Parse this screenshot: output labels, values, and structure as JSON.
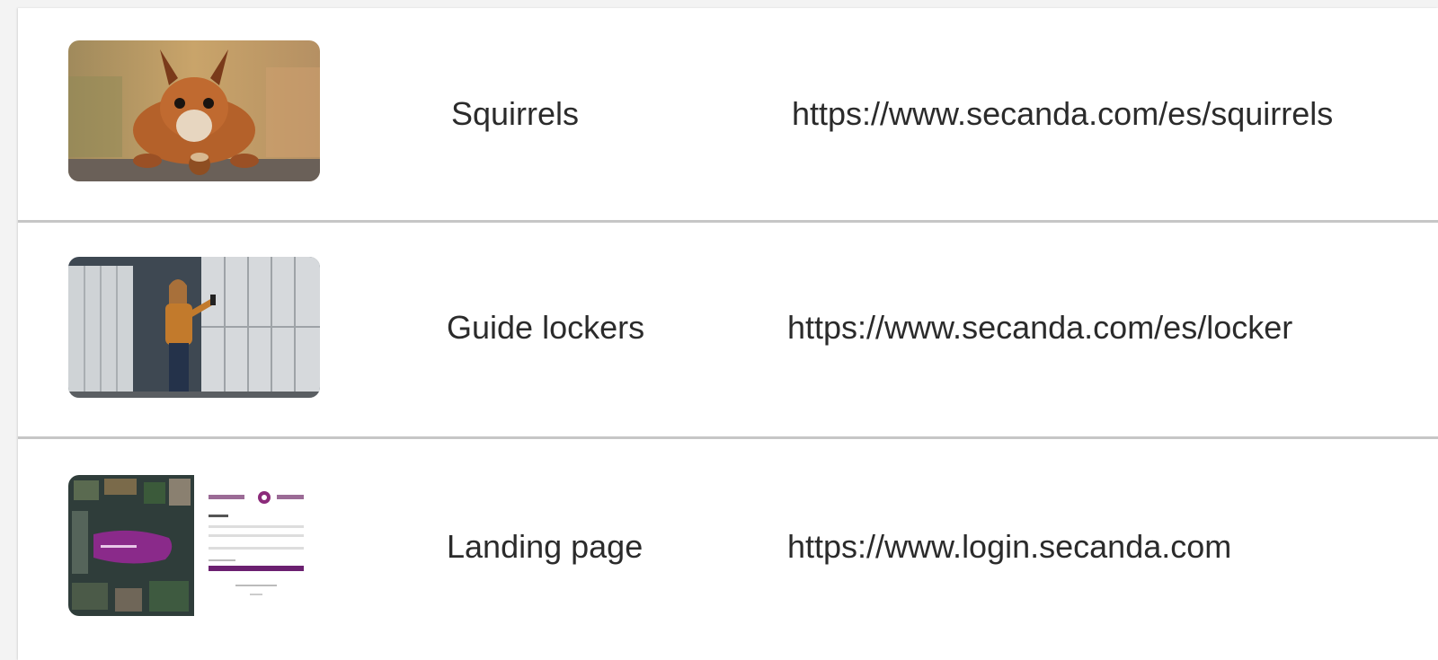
{
  "links": [
    {
      "label": "Squirrels",
      "url": "https://www.secanda.com/es/squirrels",
      "thumbnail_subject": "red squirrel with a nut"
    },
    {
      "label": "Guide lockers",
      "url": "https://www.secanda.com/es/locker",
      "thumbnail_subject": "person using smart locker"
    },
    {
      "label": "Landing page",
      "url": "https://www.login.secanda.com",
      "thumbnail_subject": "secure core login page screenshot"
    }
  ],
  "colors": {
    "page_background": "#f3f3f3",
    "panel_background": "#ffffff",
    "divider": "#c6c6c6",
    "text": "#2b2b2b",
    "brand_purple": "#8b2a7a"
  }
}
